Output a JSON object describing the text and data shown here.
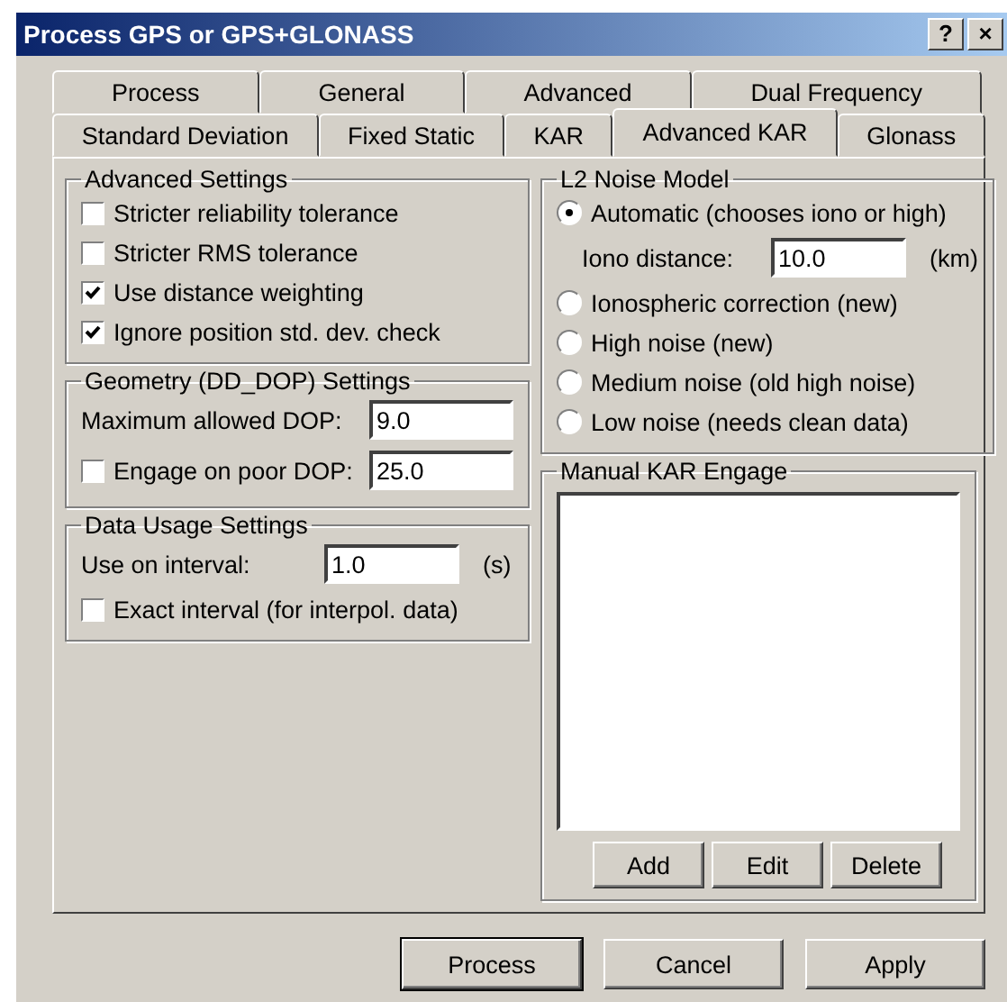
{
  "window": {
    "title": "Process GPS or GPS+GLONASS",
    "title_buttons": [
      "?",
      "×"
    ]
  },
  "tabs": [
    [
      {
        "label": "Process",
        "selected": false
      },
      {
        "label": "General",
        "selected": false
      },
      {
        "label": "Advanced",
        "selected": false
      },
      {
        "label": "Dual Frequency",
        "selected": false
      }
    ],
    [
      {
        "label": "Standard Deviation",
        "selected": false
      },
      {
        "label": "Fixed Static",
        "selected": false
      },
      {
        "label": "KAR",
        "selected": false
      },
      {
        "label": "Advanced KAR",
        "selected": true
      },
      {
        "label": "Glonass",
        "selected": false
      }
    ]
  ],
  "advanced_settings": {
    "title": "Advanced Settings",
    "checkboxes": [
      {
        "label": "Stricter reliability tolerance",
        "checked": false
      },
      {
        "label": "Stricter RMS tolerance",
        "checked": false
      },
      {
        "label": "Use distance weighting",
        "checked": true
      },
      {
        "label": "Ignore position std. dev. check",
        "checked": true
      }
    ]
  },
  "geometry": {
    "title": "Geometry (DD_DOP) Settings",
    "rows": [
      {
        "kind": "field",
        "label": "Maximum allowed DOP:",
        "value": "9.0"
      },
      {
        "kind": "checkfield",
        "label": "Engage on poor DOP:",
        "checked": false,
        "value": "25.0"
      }
    ]
  },
  "data_usage": {
    "title": "Data Usage Settings",
    "rows": [
      {
        "kind": "field",
        "label": "Use on interval:",
        "value": "1.0",
        "unit": "(s)"
      },
      {
        "kind": "check",
        "label": "Exact interval (for interpol. data)",
        "checked": false
      }
    ]
  },
  "l2_noise": {
    "title": "L2 Noise Model",
    "options": [
      {
        "label": "Automatic (chooses iono or high)",
        "selected": true,
        "field": {
          "label": "Iono distance:",
          "value": "10.0",
          "unit": "(km)"
        }
      },
      {
        "label": "Ionospheric correction (new)",
        "selected": false
      },
      {
        "label": "High noise (new)",
        "selected": false
      },
      {
        "label": "Medium noise (old high noise)",
        "selected": false
      },
      {
        "label": "Low noise (needs clean data)",
        "selected": false
      }
    ]
  },
  "manual_kar": {
    "title": "Manual KAR Engage",
    "buttons": [
      "Add",
      "Edit",
      "Delete"
    ]
  },
  "buttons": [
    {
      "label": "Process",
      "default": true
    },
    {
      "label": "Cancel",
      "default": false
    },
    {
      "label": "Apply",
      "default": false
    }
  ]
}
